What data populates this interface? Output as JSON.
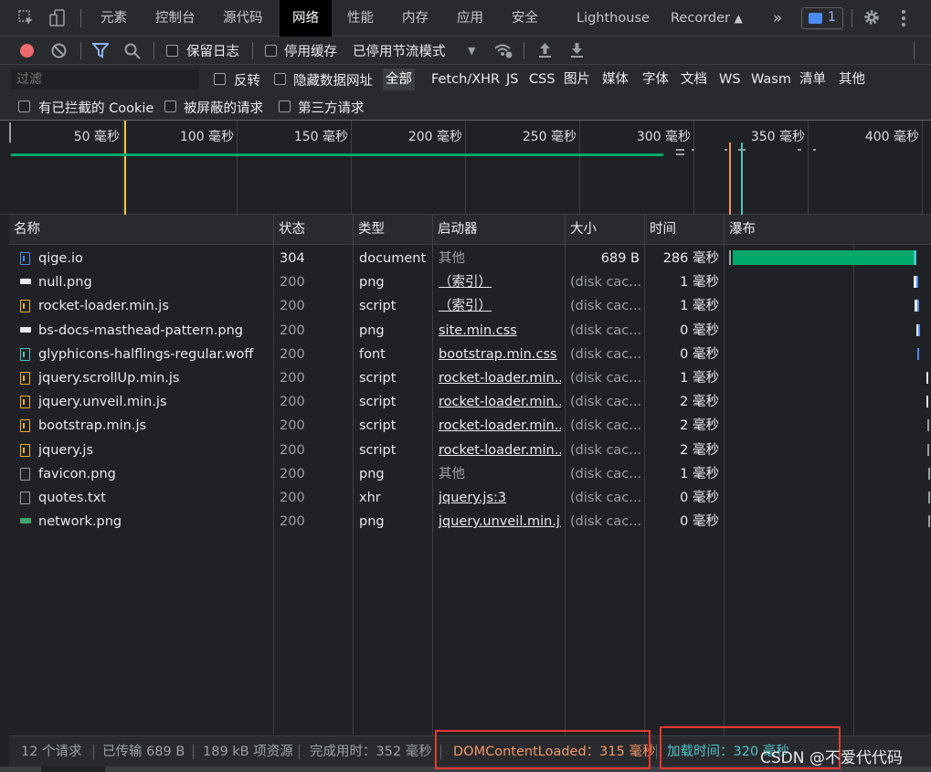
{
  "tabs": {
    "elements": "元素",
    "console": "控制台",
    "sources": "源代码",
    "network": "网络",
    "performance": "性能",
    "memory": "内存",
    "application": "应用",
    "security": "安全",
    "lighthouse": "Lighthouse",
    "recorder": "Recorder",
    "more": "»",
    "issues_count": "1"
  },
  "toolbar": {
    "preserve_log": "保留日志",
    "disable_cache": "停用缓存",
    "throttle": "已停用节流模式"
  },
  "filter": {
    "placeholder": "过滤",
    "invert": "反转",
    "hide_data_urls": "隐藏数据网址",
    "types": [
      "全部",
      "Fetch/XHR",
      "JS",
      "CSS",
      "图片",
      "媒体",
      "字体",
      "文档",
      "WS",
      "Wasm",
      "清单",
      "其他"
    ],
    "blocked_cookies": "有已拦截的 Cookie",
    "blocked_requests": "被屏蔽的请求",
    "third_party": "第三方请求"
  },
  "overview": {
    "ticks": [
      "50 毫秒",
      "100 毫秒",
      "150 毫秒",
      "200 毫秒",
      "250 毫秒",
      "300 毫秒",
      "350 毫秒",
      "400 毫秒"
    ]
  },
  "table": {
    "headers": {
      "name": "名称",
      "status": "状态",
      "type": "类型",
      "initiator": "启动器",
      "size": "大小",
      "time": "时间",
      "waterfall": "瀑布"
    },
    "rows": [
      {
        "name": "qige.io",
        "status": "304",
        "type": "document",
        "initiator": "其他",
        "size": "689 B",
        "time": "286 毫秒",
        "icon": "document-icon",
        "initiator_link": false,
        "status_dim": false
      },
      {
        "name": "null.png",
        "status": "200",
        "type": "png",
        "initiator": "（索引）",
        "size": "(disk cac...",
        "time": "1 毫秒",
        "icon": "image-icon",
        "initiator_link": true,
        "status_dim": true
      },
      {
        "name": "rocket-loader.min.js",
        "status": "200",
        "type": "script",
        "initiator": "（索引）",
        "size": "(disk cac...",
        "time": "1 毫秒",
        "icon": "script-icon",
        "initiator_link": true,
        "status_dim": true
      },
      {
        "name": "bs-docs-masthead-pattern.png",
        "status": "200",
        "type": "png",
        "initiator": "site.min.css",
        "size": "(disk cac...",
        "time": "0 毫秒",
        "icon": "image-icon",
        "initiator_link": true,
        "status_dim": true
      },
      {
        "name": "glyphicons-halflings-regular.woff",
        "status": "200",
        "type": "font",
        "initiator": "bootstrap.min.css",
        "size": "(disk cac...",
        "time": "0 毫秒",
        "icon": "font-icon",
        "initiator_link": true,
        "status_dim": true
      },
      {
        "name": "jquery.scrollUp.min.js",
        "status": "200",
        "type": "script",
        "initiator": "rocket-loader.min...",
        "size": "(disk cac...",
        "time": "1 毫秒",
        "icon": "script-icon",
        "initiator_link": true,
        "status_dim": true
      },
      {
        "name": "jquery.unveil.min.js",
        "status": "200",
        "type": "script",
        "initiator": "rocket-loader.min...",
        "size": "(disk cac...",
        "time": "2 毫秒",
        "icon": "script-icon",
        "initiator_link": true,
        "status_dim": true
      },
      {
        "name": "bootstrap.min.js",
        "status": "200",
        "type": "script",
        "initiator": "rocket-loader.min...",
        "size": "(disk cac...",
        "time": "2 毫秒",
        "icon": "script-icon",
        "initiator_link": true,
        "status_dim": true
      },
      {
        "name": "jquery.js",
        "status": "200",
        "type": "script",
        "initiator": "rocket-loader.min...",
        "size": "(disk cac...",
        "time": "2 毫秒",
        "icon": "script-icon",
        "initiator_link": true,
        "status_dim": true
      },
      {
        "name": "favicon.png",
        "status": "200",
        "type": "png",
        "initiator": "其他",
        "size": "(disk cac...",
        "time": "1 毫秒",
        "icon": "blank-file-icon",
        "initiator_link": false,
        "status_dim": true
      },
      {
        "name": "quotes.txt",
        "status": "200",
        "type": "xhr",
        "initiator": "jquery.js:3",
        "size": "(disk cac...",
        "time": "0 毫秒",
        "icon": "blank-file-icon",
        "initiator_link": true,
        "status_dim": true
      },
      {
        "name": "network.png",
        "status": "200",
        "type": "png",
        "initiator": "jquery.unveil.min.j...",
        "size": "(disk cac...",
        "time": "0 毫秒",
        "icon": "image-icon",
        "initiator_link": true,
        "status_dim": true
      }
    ]
  },
  "status": {
    "requests": "12 个请求",
    "transferred": "已传输 689 B",
    "resources": "189 kB 项资源",
    "finish": "完成用时：352 毫秒",
    "dom_content_loaded": "DOMContentLoaded：315 毫秒",
    "load": "加载时间：320 毫秒"
  },
  "watermark": "CSDN @不爱代代码",
  "colors": {
    "dcl": "#f29766",
    "load": "#4fc3c9",
    "bar_green": "#00a86b",
    "highlight_box": "#e53935"
  }
}
